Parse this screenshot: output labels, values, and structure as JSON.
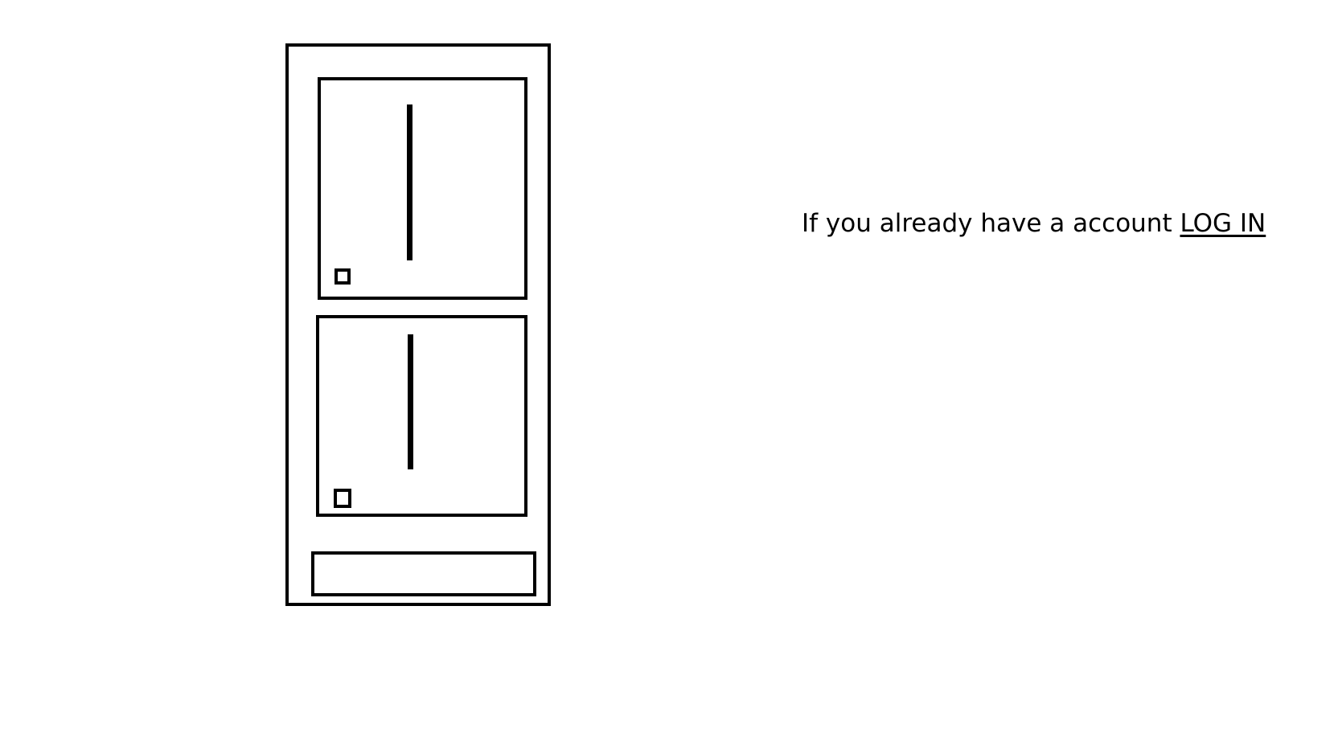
{
  "login_prompt": {
    "text": "If you already have a account ",
    "link_label": "LOG IN"
  }
}
